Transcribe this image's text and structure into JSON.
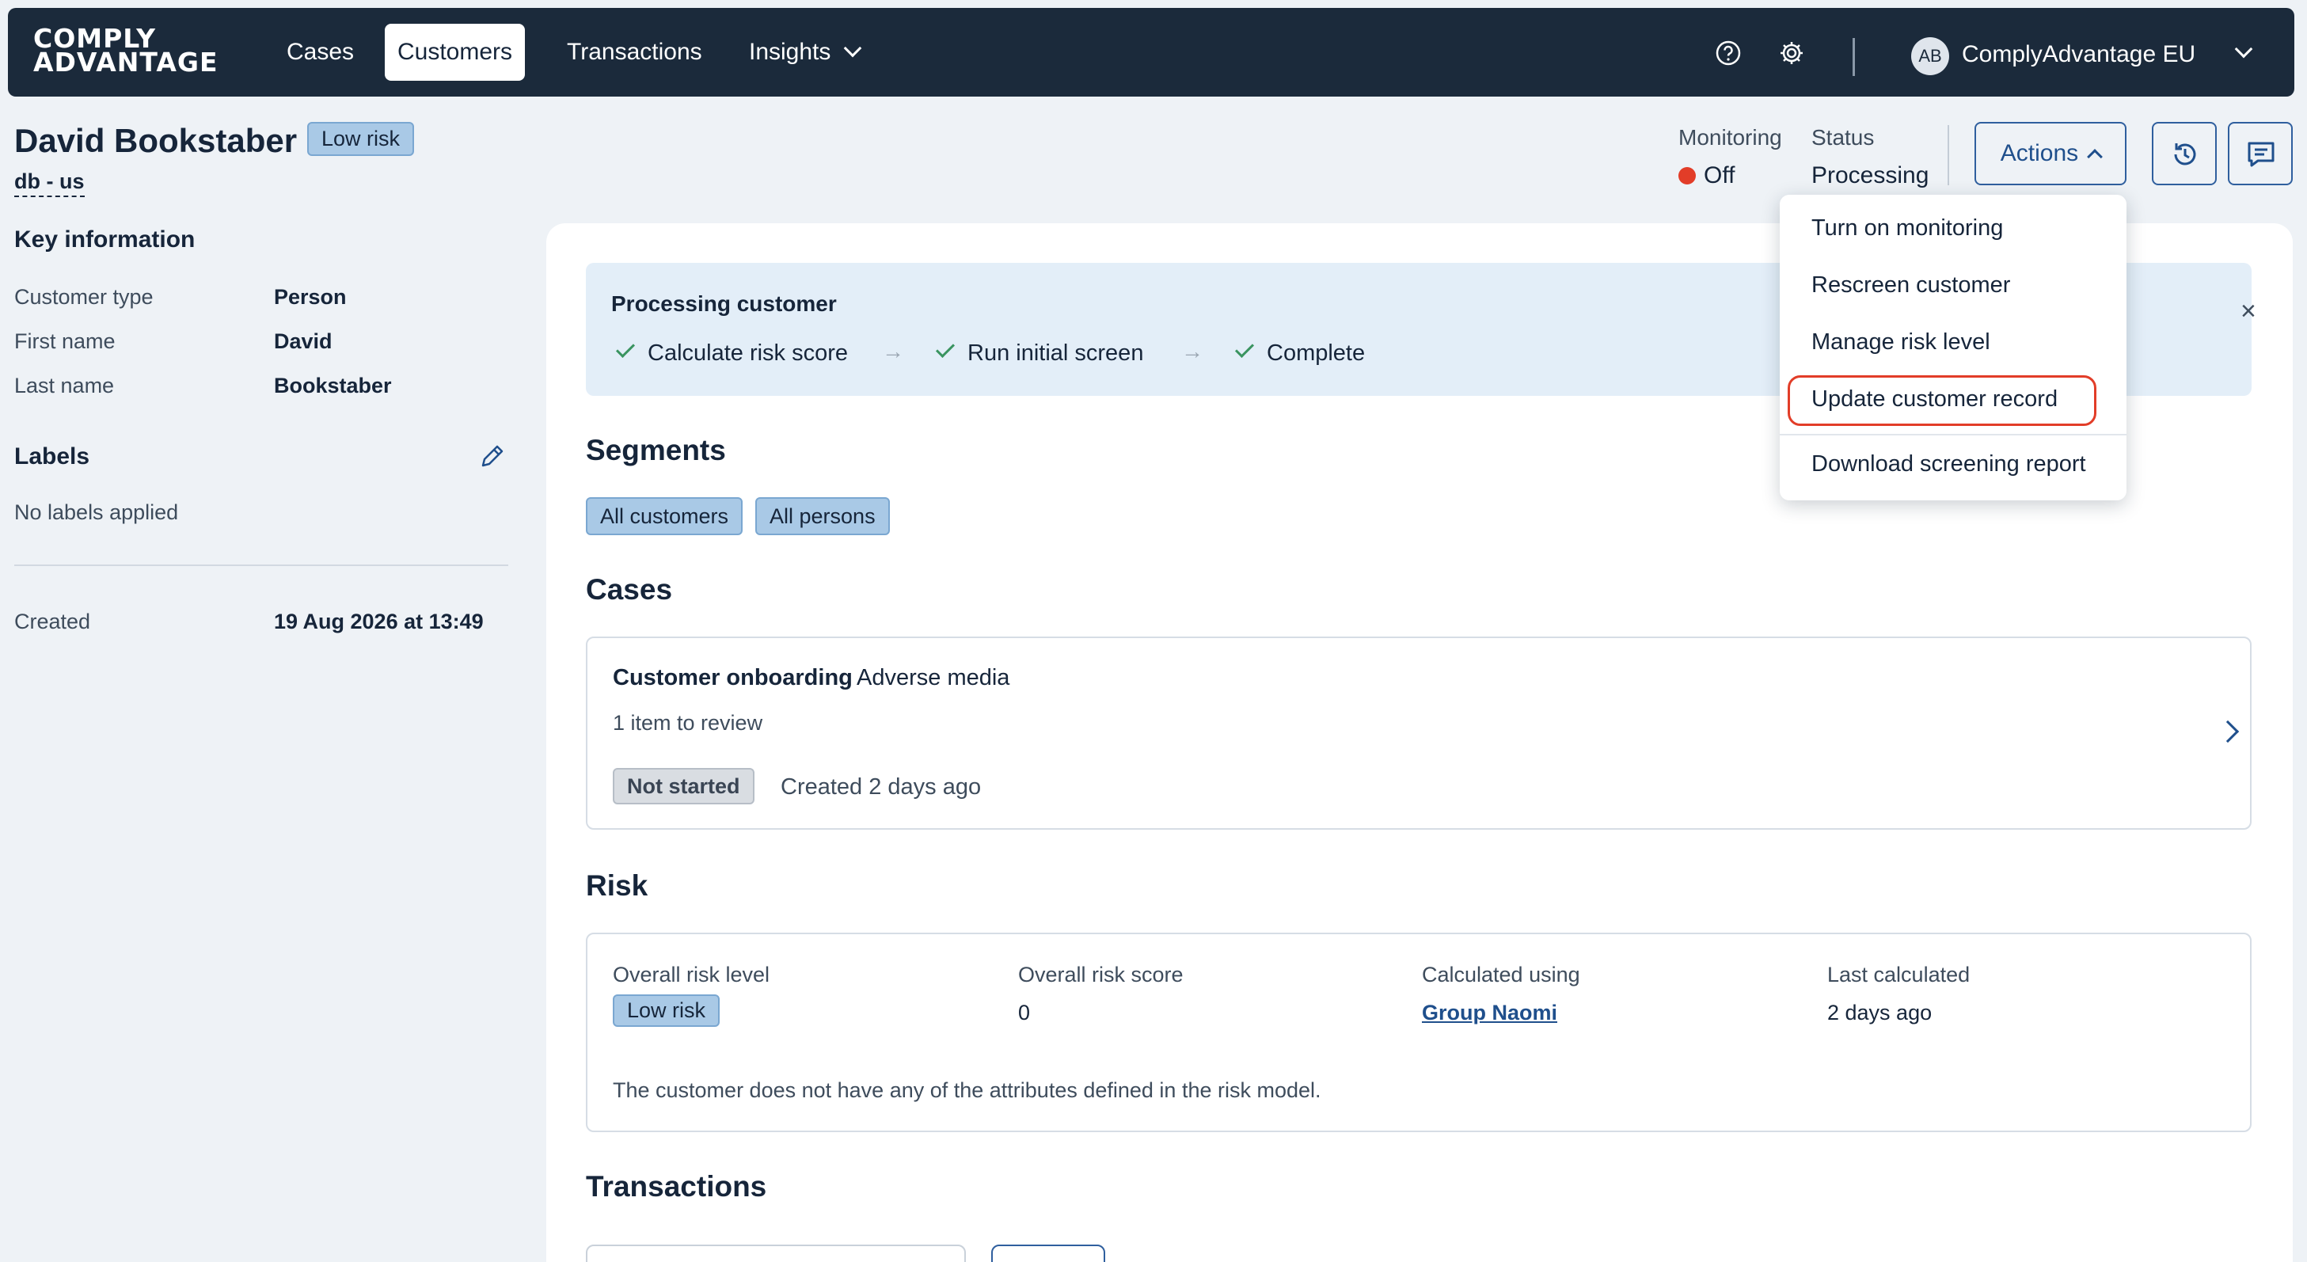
{
  "nav": {
    "logo_line1": "COMPLY",
    "logo_line2": "ADVANTAGE",
    "items": [
      {
        "label": "Cases"
      },
      {
        "label": "Customers"
      },
      {
        "label": "Transactions"
      },
      {
        "label": "Insights"
      }
    ],
    "active": "Customers",
    "avatar_initials": "AB",
    "org_name": "ComplyAdvantage EU"
  },
  "customer": {
    "name": "David Bookstaber",
    "risk_badge": "Low risk",
    "id": "db - us"
  },
  "header": {
    "monitoring_label": "Monitoring",
    "monitoring_value": "Off",
    "status_label": "Status",
    "status_value": "Processing",
    "actions_label": "Actions"
  },
  "key_info": {
    "title": "Key information",
    "rows": [
      {
        "key": "Customer type",
        "value": "Person"
      },
      {
        "key": "First name",
        "value": "David"
      },
      {
        "key": "Last name",
        "value": "Bookstaber"
      }
    ]
  },
  "labels": {
    "title": "Labels",
    "empty": "No labels applied"
  },
  "created": {
    "key": "Created",
    "value": "19 Aug 2026 at 13:49"
  },
  "banner": {
    "title": "Processing customer",
    "steps": [
      "Calculate risk score",
      "Run initial screen",
      "Complete"
    ]
  },
  "segments": {
    "title": "Segments",
    "chips": [
      "All customers",
      "All persons"
    ]
  },
  "cases": {
    "title": "Cases",
    "item": {
      "type": "Customer onboarding",
      "subtype": "Adverse media",
      "items_to_review": "1 item to review",
      "status": "Not started",
      "created": "Created 2 days ago"
    }
  },
  "risk": {
    "title": "Risk",
    "overall_level_label": "Overall risk level",
    "overall_level_value": "Low risk",
    "overall_score_label": "Overall risk score",
    "overall_score_value": "0",
    "calculated_using_label": "Calculated using",
    "calculated_using_value": "Group Naomi",
    "last_calculated_label": "Last calculated",
    "last_calculated_value": "2 days ago",
    "note": "The customer does not have any of the attributes defined in the risk model."
  },
  "transactions": {
    "title": "Transactions"
  },
  "actions_menu": {
    "items": [
      "Turn on monitoring",
      "Rescreen customer",
      "Manage risk level",
      "Update customer record",
      "Download screening report"
    ],
    "highlighted": "Update customer record"
  },
  "colors": {
    "nav_bg": "#1b2a3b",
    "accent": "#1f4f8c",
    "badge_bg": "#a9c9e6",
    "highlight": "#e23d28",
    "success": "#3a9460"
  }
}
